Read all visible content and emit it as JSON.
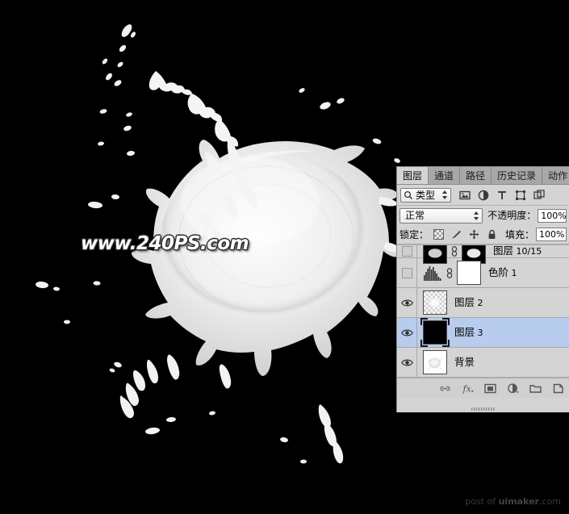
{
  "canvas": {
    "background_color": "#000000",
    "subject": "milk-splash-crown",
    "subject_color": "#f2f2f2"
  },
  "watermark": {
    "text": "www.240PS.com",
    "color": "#ffffff",
    "outline_color": "#2b2b2b"
  },
  "credit": {
    "prefix": "post of ",
    "brand": "uimaker",
    "suffix": ".com",
    "color": "#3a3a3a"
  },
  "layers_panel": {
    "tabs": [
      {
        "label": "图层",
        "active": true
      },
      {
        "label": "通道",
        "active": false
      },
      {
        "label": "路径",
        "active": false
      },
      {
        "label": "历史记录",
        "active": false
      },
      {
        "label": "动作",
        "active": false
      }
    ],
    "filter_row": {
      "search_icon": "magnifier-icon",
      "filter_type_value": "类型",
      "icons": [
        "pixel-layer-filter-icon",
        "adjustment-layer-filter-icon",
        "type-layer-filter-icon",
        "shape-layer-filter-icon",
        "smart-object-filter-icon"
      ]
    },
    "blend_row": {
      "blend_mode": "正常",
      "opacity_label": "不透明度：",
      "opacity_value": "100%"
    },
    "lock_row": {
      "lock_label": "锁定：",
      "lock_icons": [
        "lock-transparent-pixels-icon",
        "lock-image-pixels-icon",
        "lock-position-icon",
        "lock-all-icon"
      ],
      "fill_label": "填充：",
      "fill_value": "100%"
    },
    "layers": [
      {
        "name": "图层",
        "suffix": " 10/15",
        "visible": false,
        "selected": false,
        "clipped": true,
        "thumb": "black-masked",
        "has_mask": true
      },
      {
        "name": "色阶",
        "suffix": " 1",
        "visible": false,
        "selected": false,
        "clipped": false,
        "thumb": "levels-histogram",
        "has_mask": true,
        "mask_color": "#ffffff"
      },
      {
        "name": "图层",
        "suffix": " 2",
        "visible": true,
        "selected": false,
        "clipped": false,
        "thumb": "transparent-splash",
        "has_mask": false
      },
      {
        "name": "图层",
        "suffix": " 3",
        "visible": true,
        "selected": true,
        "clipped": false,
        "thumb": "solid-black",
        "has_mask": false
      },
      {
        "name": "背景",
        "suffix": "",
        "visible": true,
        "selected": false,
        "clipped": false,
        "thumb": "white-splash",
        "has_mask": false
      }
    ],
    "footer_buttons": [
      "link-layers-icon",
      "layer-style-fx-icon",
      "add-layer-mask-icon",
      "new-adjustment-layer-icon",
      "new-group-icon",
      "new-layer-icon"
    ],
    "selection_color": "#b8cced",
    "panel_background": "#d4d4d4"
  }
}
